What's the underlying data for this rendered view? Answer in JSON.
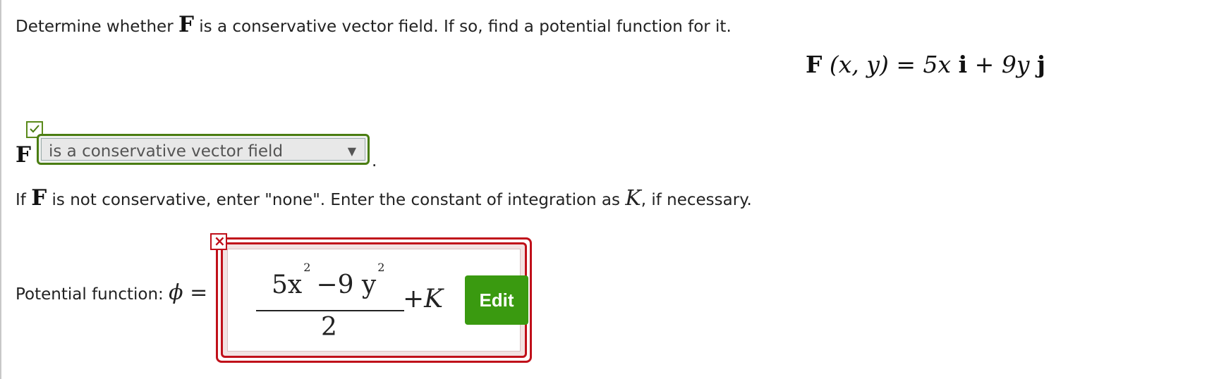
{
  "question": {
    "line1_pre": "Determine whether ",
    "F": "F",
    "line1_post": " is a conservative vector field. If so, find a potential function for it."
  },
  "formula": {
    "F": "F",
    "args": " (x, y) = 5x ",
    "i": "i",
    "mid": " + 9y ",
    "j": "j"
  },
  "conservative": {
    "F": "F",
    "selected": "is a conservative vector field",
    "arrow": "▼",
    "period": ".",
    "status": "correct"
  },
  "instructions": {
    "pre": "If ",
    "F": "F",
    "mid": " is not conservative, enter \"none\". Enter the constant of integration as ",
    "K": "K",
    "post": ", if necessary."
  },
  "potential": {
    "label": "Potential function: ",
    "phi": "ϕ",
    "eq": " =",
    "numer_coef1": "5x",
    "numer_exp1": "2",
    "numer_mid": "−9 y",
    "numer_exp2": "2",
    "denom": "2",
    "plus_K": "+K",
    "edit_label": "Edit",
    "status": "incorrect",
    "x_mark": "×"
  },
  "colors": {
    "correct": "#4a7d12",
    "incorrect": "#c0101a",
    "edit_button": "#3a9a10"
  }
}
